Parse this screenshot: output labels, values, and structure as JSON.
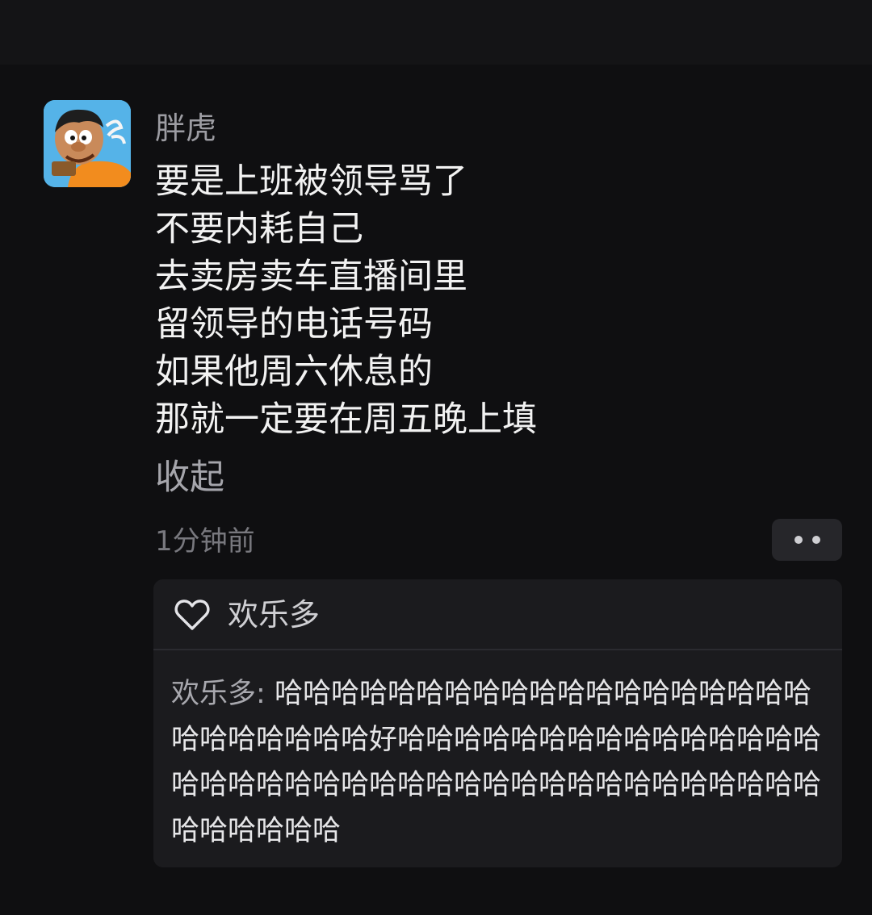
{
  "post": {
    "author": "胖虎",
    "lines": [
      "要是上班被领导骂了",
      "不要内耗自己",
      "去卖房卖车直播间里",
      "留领导的电话号码",
      "如果他周六休息的",
      "那就一定要在周五晚上填"
    ],
    "collapse_label": "收起",
    "time": "1分钟前",
    "avatar_icon": "cartoon-avatar-icon"
  },
  "likes": {
    "icon": "heart-icon",
    "names": "欢乐多"
  },
  "comment": {
    "author": "欢乐多",
    "separator": ": ",
    "text": "哈哈哈哈哈哈哈哈哈哈哈哈哈哈哈哈哈哈哈哈哈哈哈哈哈哈好哈哈哈哈哈哈哈哈哈哈哈哈哈哈哈哈哈哈哈哈哈哈哈哈哈哈哈哈哈哈哈哈哈哈哈哈哈哈哈哈哈哈哈哈"
  },
  "colors": {
    "background": "#0f0f11",
    "panel": "#1b1b1e",
    "text": "#f2f2f2",
    "muted": "#78787e"
  }
}
